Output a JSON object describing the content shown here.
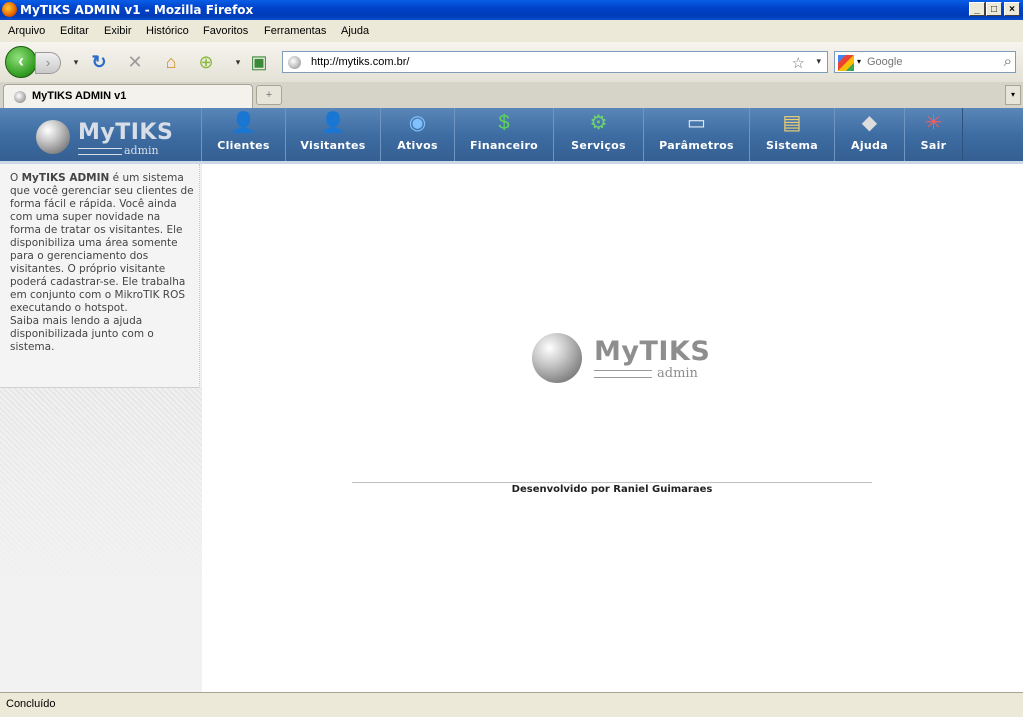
{
  "window": {
    "title": "MyTIKS ADMIN v1 - Mozilla Firefox"
  },
  "menu": [
    "Arquivo",
    "Editar",
    "Exibir",
    "Histórico",
    "Favoritos",
    "Ferramentas",
    "Ajuda"
  ],
  "toolbar": {
    "url": "http://mytiks.com.br/",
    "search_placeholder": "Google"
  },
  "tabs": [
    {
      "label": "MyTIKS ADMIN v1"
    }
  ],
  "logo": {
    "name": "MyTIKS",
    "sub": "admin"
  },
  "nav": [
    {
      "label": "Clientes",
      "icon": "user-icon",
      "color": "#3a7bd5"
    },
    {
      "label": "Visitantes",
      "icon": "visitor-icon",
      "color": "#b0b0b0"
    },
    {
      "label": "Ativos",
      "icon": "globe-icon",
      "color": "#2f8ad8"
    },
    {
      "label": "Financeiro",
      "icon": "money-bag-icon",
      "color": "#3aa335"
    },
    {
      "label": "Serviços",
      "icon": "gear-icon",
      "color": "#3d9a3d"
    },
    {
      "label": "Parâmetros",
      "icon": "monitor-icon",
      "color": "#5a8ad0"
    },
    {
      "label": "Sistema",
      "icon": "system-icon",
      "color": "#c9a23a"
    },
    {
      "label": "Ajuda",
      "icon": "help-box-icon",
      "color": "#777777"
    },
    {
      "label": "Sair",
      "icon": "exit-icon",
      "color": "#d23c3c"
    }
  ],
  "sidebar": {
    "brand": "MyTIKS ADMIN",
    "text_before": "O ",
    "text_after": " é um sistema que você gerenciar seu clientes de forma fácil e rápida. Você ainda com uma super novidade na forma de tratar os visitantes. Ele disponibiliza uma área somente para o gerenciamento dos visitantes. O próprio visitante poderá cadastrar-se. Ele trabalha em conjunto com o MikroTIK ROS executando o hotspot.",
    "text_more": "Saiba mais lendo a ajuda disponibilizada junto com o sistema."
  },
  "footer": {
    "credit": "Desenvolvido por Raniel Guimaraes"
  },
  "status": {
    "text": "Concluído"
  }
}
